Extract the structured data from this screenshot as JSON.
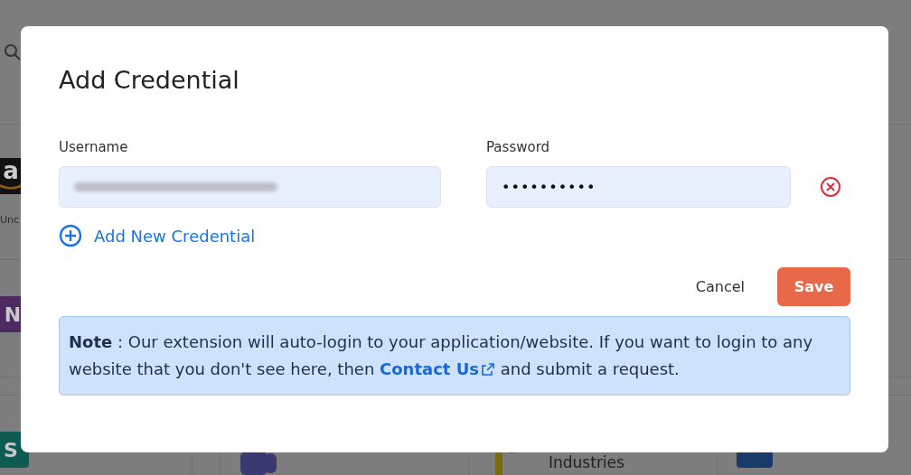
{
  "background_apps": [
    {
      "kind": "amazon",
      "letter": "a",
      "label": "Unc"
    },
    {
      "kind": "onenote",
      "letter": "N"
    },
    {
      "kind": "sway",
      "letter": "S"
    },
    {
      "kind": "teams"
    },
    {
      "kind": "industries",
      "label": "Industries"
    },
    {
      "kind": "word"
    }
  ],
  "dialog": {
    "title": "Add Credential",
    "credentials": [
      {
        "username": {
          "label": "Username",
          "value_blurred": true
        },
        "password": {
          "label": "Password",
          "value": "••••••••••"
        }
      }
    ],
    "add_link": "Add New Credential",
    "buttons": {
      "cancel": "Cancel",
      "save": "Save"
    },
    "note": {
      "lead": "**Note** : Our extension will auto-login to your application/website. If you want to login to any website that you don't see here, then",
      "link": "Contact Us",
      "tail": "and submit a request."
    }
  }
}
